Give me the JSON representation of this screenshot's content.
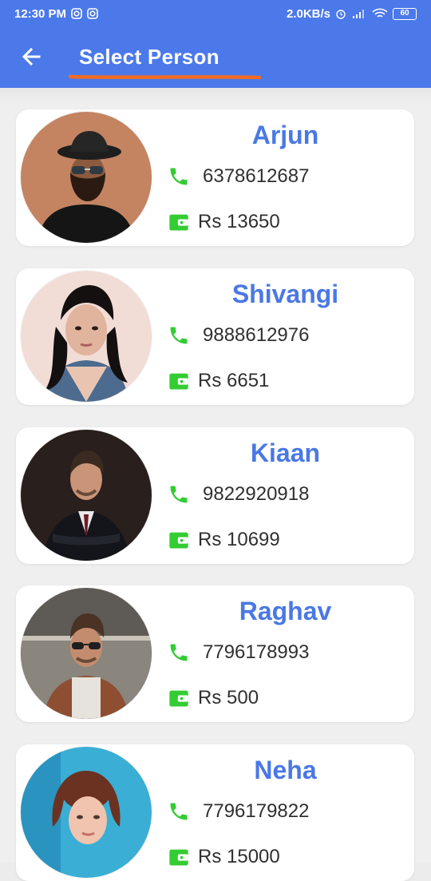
{
  "status_bar": {
    "time": "12:30 PM",
    "network_speed": "2.0KB/s",
    "battery": "60"
  },
  "app_bar": {
    "title": "Select Person",
    "back_icon": "arrow-back-icon",
    "underline_color": "#f26b22"
  },
  "colors": {
    "primary": "#4b79ea",
    "name_text": "#4a78e4",
    "icon_green": "#33cc33"
  },
  "persons": [
    {
      "name": "Arjun",
      "phone": "6378612687",
      "wallet": "Rs 13650"
    },
    {
      "name": "Shivangi",
      "phone": "9888612976",
      "wallet": "Rs 6651"
    },
    {
      "name": "Kiaan",
      "phone": "9822920918",
      "wallet": "Rs 10699"
    },
    {
      "name": "Raghav",
      "phone": "7796178993",
      "wallet": "Rs 500"
    },
    {
      "name": "Neha",
      "phone": "7796179822",
      "wallet": "Rs 15000"
    }
  ]
}
